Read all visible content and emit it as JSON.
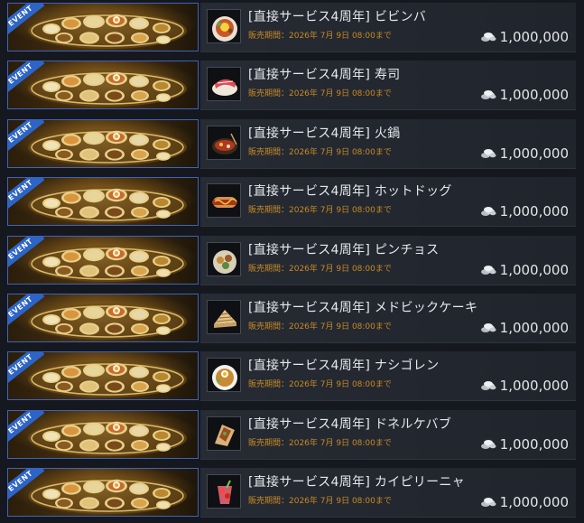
{
  "items": [
    {
      "badge": "EVENT",
      "title": "[直接サービス4周年] ビビンバ",
      "period": "販売期間：2026年 7月 9日 08:00まで",
      "price": "1,000,000",
      "icon": "bibimbap-icon"
    },
    {
      "badge": "EVENT",
      "title": "[直接サービス4周年] 寿司",
      "period": "販売期間：2026年 7月 9日 08:00まで",
      "price": "1,000,000",
      "icon": "sushi-icon"
    },
    {
      "badge": "EVENT",
      "title": "[直接サービス4周年] 火鍋",
      "period": "販売期間：2026年 7月 9日 08:00まで",
      "price": "1,000,000",
      "icon": "hotpot-icon"
    },
    {
      "badge": "EVENT",
      "title": "[直接サービス4周年] ホットドッグ",
      "period": "販売期間：2026年 7月 9日 08:00まで",
      "price": "1,000,000",
      "icon": "hotdog-icon"
    },
    {
      "badge": "EVENT",
      "title": "[直接サービス4周年] ピンチョス",
      "period": "販売期間：2026年 7月 9日 08:00まで",
      "price": "1,000,000",
      "icon": "pinchos-icon"
    },
    {
      "badge": "EVENT",
      "title": "[直接サービス4周年] メドビックケーキ",
      "period": "販売期間：2026年 7月 9日 08:00まで",
      "price": "1,000,000",
      "icon": "medovik-cake-icon"
    },
    {
      "badge": "EVENT",
      "title": "[直接サービス4周年] ナシゴレン",
      "period": "販売期間：2026年 7月 9日 08:00まで",
      "price": "1,000,000",
      "icon": "nasi-goreng-icon"
    },
    {
      "badge": "EVENT",
      "title": "[直接サービス4周年] ドネルケバブ",
      "period": "販売期間：2026年 7月 9日 08:00まで",
      "price": "1,000,000",
      "icon": "doner-kebab-icon"
    },
    {
      "badge": "EVENT",
      "title": "[直接サービス4周年] カイピリーニャ",
      "period": "販売期間：2026年 7月 9日 08:00まで",
      "price": "1,000,000",
      "icon": "caipirinha-icon"
    }
  ],
  "currency_icon": "silver-coin-icon",
  "colors": {
    "accent_blue": "#2c64c8",
    "period_orange": "#c88a24",
    "text": "#e6e8ec"
  }
}
